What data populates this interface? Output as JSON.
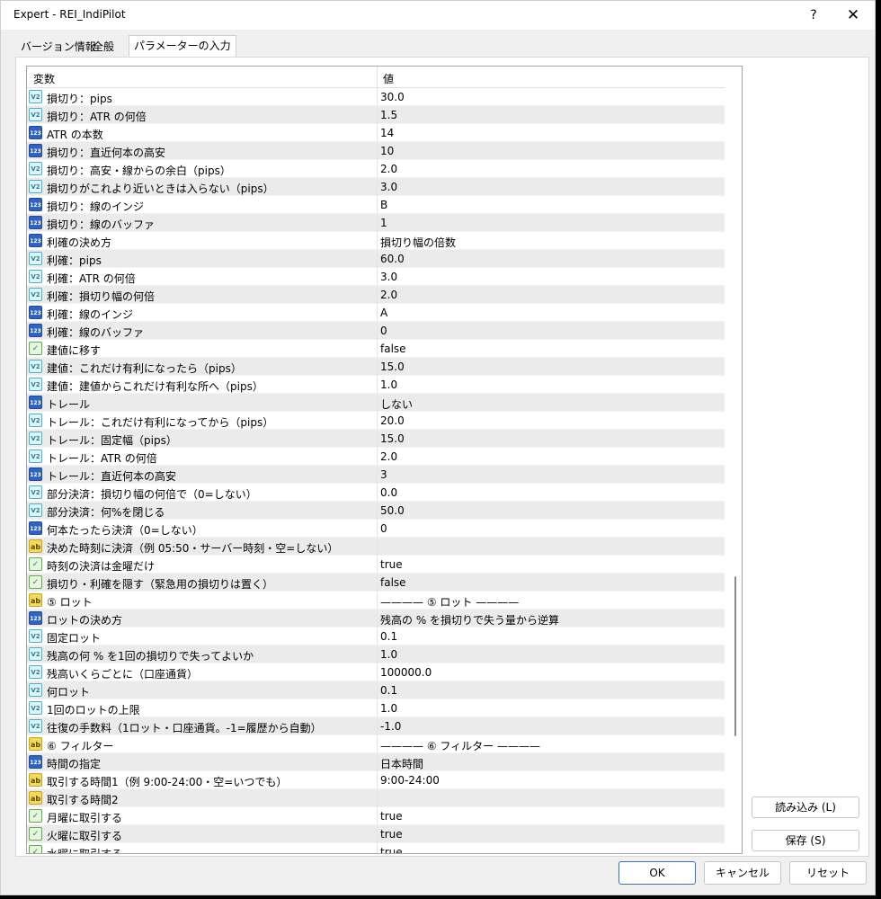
{
  "window": {
    "title": "Expert - REI_IndiPilot",
    "help": "?",
    "close": "✕"
  },
  "tabs": [
    "バージョン情報",
    "全般",
    "パラメーターの入力"
  ],
  "grid": {
    "header_name": "変数",
    "header_value": "値",
    "rows": [
      {
        "icon": "v2",
        "name": "損切り：pips",
        "value": "30.0"
      },
      {
        "icon": "v2",
        "name": "損切り：ATR の何倍",
        "value": "1.5"
      },
      {
        "icon": "n123",
        "name": "ATR の本数",
        "value": "14"
      },
      {
        "icon": "n123",
        "name": "損切り：直近何本の高安",
        "value": "10"
      },
      {
        "icon": "v2",
        "name": "損切り：高安・線からの余白（pips）",
        "value": "2.0"
      },
      {
        "icon": "v2",
        "name": "損切りがこれより近いときは入らない（pips）",
        "value": "3.0"
      },
      {
        "icon": "n123",
        "name": "損切り：線のインジ",
        "value": "B"
      },
      {
        "icon": "n123",
        "name": "損切り：線のバッファ",
        "value": "1"
      },
      {
        "icon": "n123",
        "name": "利確の決め方",
        "value": "損切り幅の倍数"
      },
      {
        "icon": "v2",
        "name": "利確：pips",
        "value": "60.0"
      },
      {
        "icon": "v2",
        "name": "利確：ATR の何倍",
        "value": "3.0"
      },
      {
        "icon": "v2",
        "name": "利確：損切り幅の何倍",
        "value": "2.0"
      },
      {
        "icon": "n123",
        "name": "利確：線のインジ",
        "value": "A"
      },
      {
        "icon": "n123",
        "name": "利確：線のバッファ",
        "value": "0"
      },
      {
        "icon": "bool",
        "name": "建値に移す",
        "value": "false"
      },
      {
        "icon": "v2",
        "name": "建値：これだけ有利になったら（pips）",
        "value": "15.0"
      },
      {
        "icon": "v2",
        "name": "建値：建値からこれだけ有利な所へ（pips）",
        "value": "1.0"
      },
      {
        "icon": "n123",
        "name": "トレール",
        "value": "しない"
      },
      {
        "icon": "v2",
        "name": "トレール：これだけ有利になってから（pips）",
        "value": "20.0"
      },
      {
        "icon": "v2",
        "name": "トレール：固定幅（pips）",
        "value": "15.0"
      },
      {
        "icon": "v2",
        "name": "トレール：ATR の何倍",
        "value": "2.0"
      },
      {
        "icon": "n123",
        "name": "トレール：直近何本の高安",
        "value": "3"
      },
      {
        "icon": "v2",
        "name": "部分決済：損切り幅の何倍で（0=しない）",
        "value": "0.0"
      },
      {
        "icon": "v2",
        "name": "部分決済：何%を閉じる",
        "value": "50.0"
      },
      {
        "icon": "n123",
        "name": "何本たったら決済（0=しない）",
        "value": "0"
      },
      {
        "icon": "ab",
        "name": "決めた時刻に決済（例 05:50・サーバー時刻・空=しない）",
        "value": ""
      },
      {
        "icon": "bool",
        "name": "時刻の決済は金曜だけ",
        "value": "true"
      },
      {
        "icon": "bool",
        "name": "損切り・利確を隠す（緊急用の損切りは置く）",
        "value": "false"
      },
      {
        "icon": "ab",
        "name": "⑤ ロット",
        "value": "———— ⑤ ロット ————"
      },
      {
        "icon": "n123",
        "name": "ロットの決め方",
        "value": "残高の % を損切りで失う量から逆算"
      },
      {
        "icon": "v2",
        "name": "固定ロット",
        "value": "0.1"
      },
      {
        "icon": "v2",
        "name": "残高の何 % を1回の損切りで失ってよいか",
        "value": "1.0"
      },
      {
        "icon": "v2",
        "name": "残高いくらごとに（口座通貨）",
        "value": "100000.0"
      },
      {
        "icon": "v2",
        "name": "何ロット",
        "value": "0.1"
      },
      {
        "icon": "v2",
        "name": "1回のロットの上限",
        "value": "1.0"
      },
      {
        "icon": "v2",
        "name": "往復の手数料（1ロット・口座通貨。-1=履歴から自動）",
        "value": "-1.0"
      },
      {
        "icon": "ab",
        "name": "⑥ フィルター",
        "value": "———— ⑥ フィルター ————"
      },
      {
        "icon": "n123",
        "name": "時間の指定",
        "value": "日本時間"
      },
      {
        "icon": "ab",
        "name": "取引する時間1（例 9:00-24:00・空=いつでも）",
        "value": "9:00-24:00"
      },
      {
        "icon": "ab",
        "name": "取引する時間2",
        "value": ""
      },
      {
        "icon": "bool",
        "name": "月曜に取引する",
        "value": "true"
      },
      {
        "icon": "bool",
        "name": "火曜に取引する",
        "value": "true"
      },
      {
        "icon": "bool",
        "name": "水曜に取引する",
        "value": "true"
      }
    ]
  },
  "side_buttons": {
    "load": "読み込み (L)",
    "save": "保存 (S)"
  },
  "bottom_buttons": {
    "ok": "OK",
    "cancel": "キャンセル",
    "reset": "リセット"
  },
  "icons": {
    "v2": "V2",
    "n123": "123",
    "bool": "✓",
    "ab": "ab"
  }
}
